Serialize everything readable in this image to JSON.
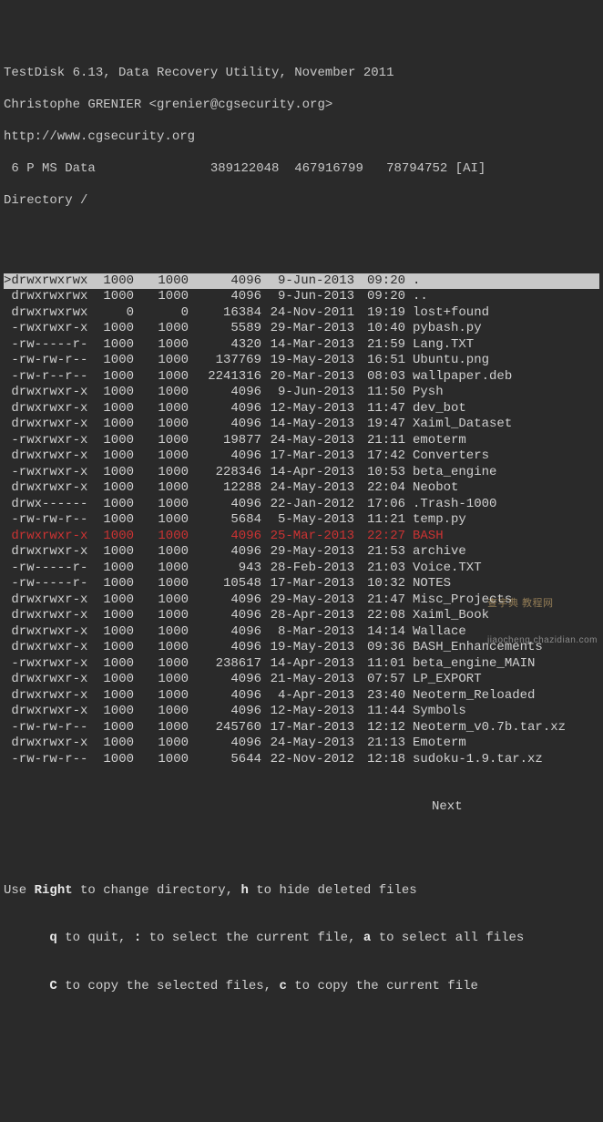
{
  "header": {
    "line1": "TestDisk 6.13, Data Recovery Utility, November 2011",
    "line2": "Christophe GRENIER <grenier@cgsecurity.org>",
    "line3": "http://www.cgsecurity.org",
    "partition": " 6 P MS Data               389122048  467916799   78794752 [AI]",
    "directory": "Directory /"
  },
  "rows": [
    {
      "sel": true,
      "del": false,
      "perms": ">drwxrwxrwx",
      "uid": "1000",
      "gid": "1000",
      "size": "4096",
      "date": "9-Jun-2013",
      "time": "09:20",
      "name": "."
    },
    {
      "sel": false,
      "del": false,
      "perms": " drwxrwxrwx",
      "uid": "1000",
      "gid": "1000",
      "size": "4096",
      "date": "9-Jun-2013",
      "time": "09:20",
      "name": ".."
    },
    {
      "sel": false,
      "del": false,
      "perms": " drwxrwxrwx",
      "uid": "0",
      "gid": "0",
      "size": "16384",
      "date": "24-Nov-2011",
      "time": "19:19",
      "name": "lost+found"
    },
    {
      "sel": false,
      "del": false,
      "perms": " -rwxrwxr-x",
      "uid": "1000",
      "gid": "1000",
      "size": "5589",
      "date": "29-Mar-2013",
      "time": "10:40",
      "name": "pybash.py"
    },
    {
      "sel": false,
      "del": false,
      "perms": " -rw-----r-",
      "uid": "1000",
      "gid": "1000",
      "size": "4320",
      "date": "14-Mar-2013",
      "time": "21:59",
      "name": "Lang.TXT"
    },
    {
      "sel": false,
      "del": false,
      "perms": " -rw-rw-r--",
      "uid": "1000",
      "gid": "1000",
      "size": "137769",
      "date": "19-May-2013",
      "time": "16:51",
      "name": "Ubuntu.png"
    },
    {
      "sel": false,
      "del": false,
      "perms": " -rw-r--r--",
      "uid": "1000",
      "gid": "1000",
      "size": "2241316",
      "date": "20-Mar-2013",
      "time": "08:03",
      "name": "wallpaper.deb"
    },
    {
      "sel": false,
      "del": false,
      "perms": " drwxrwxr-x",
      "uid": "1000",
      "gid": "1000",
      "size": "4096",
      "date": "9-Jun-2013",
      "time": "11:50",
      "name": "Pysh"
    },
    {
      "sel": false,
      "del": false,
      "perms": " drwxrwxr-x",
      "uid": "1000",
      "gid": "1000",
      "size": "4096",
      "date": "12-May-2013",
      "time": "11:47",
      "name": "dev_bot"
    },
    {
      "sel": false,
      "del": false,
      "perms": " drwxrwxr-x",
      "uid": "1000",
      "gid": "1000",
      "size": "4096",
      "date": "14-May-2013",
      "time": "19:47",
      "name": "Xaiml_Dataset"
    },
    {
      "sel": false,
      "del": false,
      "perms": " -rwxrwxr-x",
      "uid": "1000",
      "gid": "1000",
      "size": "19877",
      "date": "24-May-2013",
      "time": "21:11",
      "name": "emoterm"
    },
    {
      "sel": false,
      "del": false,
      "perms": " drwxrwxr-x",
      "uid": "1000",
      "gid": "1000",
      "size": "4096",
      "date": "17-Mar-2013",
      "time": "17:42",
      "name": "Converters"
    },
    {
      "sel": false,
      "del": false,
      "perms": " -rwxrwxr-x",
      "uid": "1000",
      "gid": "1000",
      "size": "228346",
      "date": "14-Apr-2013",
      "time": "10:53",
      "name": "beta_engine"
    },
    {
      "sel": false,
      "del": false,
      "perms": " drwxrwxr-x",
      "uid": "1000",
      "gid": "1000",
      "size": "12288",
      "date": "24-May-2013",
      "time": "22:04",
      "name": "Neobot"
    },
    {
      "sel": false,
      "del": false,
      "perms": " drwx------",
      "uid": "1000",
      "gid": "1000",
      "size": "4096",
      "date": "22-Jan-2012",
      "time": "17:06",
      "name": ".Trash-1000"
    },
    {
      "sel": false,
      "del": false,
      "perms": " -rw-rw-r--",
      "uid": "1000",
      "gid": "1000",
      "size": "5684",
      "date": "5-May-2013",
      "time": "11:21",
      "name": "temp.py"
    },
    {
      "sel": false,
      "del": true,
      "perms": " drwxrwxr-x",
      "uid": "1000",
      "gid": "1000",
      "size": "4096",
      "date": "25-Mar-2013",
      "time": "22:27",
      "name": "BASH"
    },
    {
      "sel": false,
      "del": false,
      "perms": " drwxrwxr-x",
      "uid": "1000",
      "gid": "1000",
      "size": "4096",
      "date": "29-May-2013",
      "time": "21:53",
      "name": "archive"
    },
    {
      "sel": false,
      "del": false,
      "perms": " -rw-----r-",
      "uid": "1000",
      "gid": "1000",
      "size": "943",
      "date": "28-Feb-2013",
      "time": "21:03",
      "name": "Voice.TXT"
    },
    {
      "sel": false,
      "del": false,
      "perms": " -rw-----r-",
      "uid": "1000",
      "gid": "1000",
      "size": "10548",
      "date": "17-Mar-2013",
      "time": "10:32",
      "name": "NOTES"
    },
    {
      "sel": false,
      "del": false,
      "perms": " drwxrwxr-x",
      "uid": "1000",
      "gid": "1000",
      "size": "4096",
      "date": "29-May-2013",
      "time": "21:47",
      "name": "Misc_Projects"
    },
    {
      "sel": false,
      "del": false,
      "perms": " drwxrwxr-x",
      "uid": "1000",
      "gid": "1000",
      "size": "4096",
      "date": "28-Apr-2013",
      "time": "22:08",
      "name": "Xaiml_Book"
    },
    {
      "sel": false,
      "del": false,
      "perms": " drwxrwxr-x",
      "uid": "1000",
      "gid": "1000",
      "size": "4096",
      "date": "8-Mar-2013",
      "time": "14:14",
      "name": "Wallace"
    },
    {
      "sel": false,
      "del": false,
      "perms": " drwxrwxr-x",
      "uid": "1000",
      "gid": "1000",
      "size": "4096",
      "date": "19-May-2013",
      "time": "09:36",
      "name": "BASH_Enhancements"
    },
    {
      "sel": false,
      "del": false,
      "perms": " -rwxrwxr-x",
      "uid": "1000",
      "gid": "1000",
      "size": "238617",
      "date": "14-Apr-2013",
      "time": "11:01",
      "name": "beta_engine_MAIN"
    },
    {
      "sel": false,
      "del": false,
      "perms": " drwxrwxr-x",
      "uid": "1000",
      "gid": "1000",
      "size": "4096",
      "date": "21-May-2013",
      "time": "07:57",
      "name": "LP_EXPORT"
    },
    {
      "sel": false,
      "del": false,
      "perms": " drwxrwxr-x",
      "uid": "1000",
      "gid": "1000",
      "size": "4096",
      "date": "4-Apr-2013",
      "time": "23:40",
      "name": "Neoterm_Reloaded"
    },
    {
      "sel": false,
      "del": false,
      "perms": " drwxrwxr-x",
      "uid": "1000",
      "gid": "1000",
      "size": "4096",
      "date": "12-May-2013",
      "time": "11:44",
      "name": "Symbols"
    },
    {
      "sel": false,
      "del": false,
      "perms": " -rw-rw-r--",
      "uid": "1000",
      "gid": "1000",
      "size": "245760",
      "date": "17-Mar-2013",
      "time": "12:12",
      "name": "Neoterm_v0.7b.tar.xz"
    },
    {
      "sel": false,
      "del": false,
      "perms": " drwxrwxr-x",
      "uid": "1000",
      "gid": "1000",
      "size": "4096",
      "date": "24-May-2013",
      "time": "21:13",
      "name": "Emoterm"
    },
    {
      "sel": false,
      "del": false,
      "perms": " -rw-rw-r--",
      "uid": "1000",
      "gid": "1000",
      "size": "5644",
      "date": "22-Nov-2012",
      "time": "12:18",
      "name": "sudoku-1.9.tar.xz"
    }
  ],
  "next_label": "Next",
  "footer": {
    "f1": {
      "pre": "Use ",
      "k1": "Right",
      "mid1": " to change directory, ",
      "k2": "h",
      "post": " to hide deleted files"
    },
    "f2": {
      "pre": "      ",
      "k1": "q",
      "mid1": " to quit, ",
      "k2": ":",
      "mid2": " to select the current file, ",
      "k3": "a",
      "post": " to select all files"
    },
    "f3": {
      "pre": "      ",
      "k1": "C",
      "mid1": " to copy the selected files, ",
      "k2": "c",
      "post": " to copy the current file"
    }
  },
  "watermark": {
    "main": "查字典 教程网",
    "sub": "jiaocheng.chazidian.com"
  }
}
